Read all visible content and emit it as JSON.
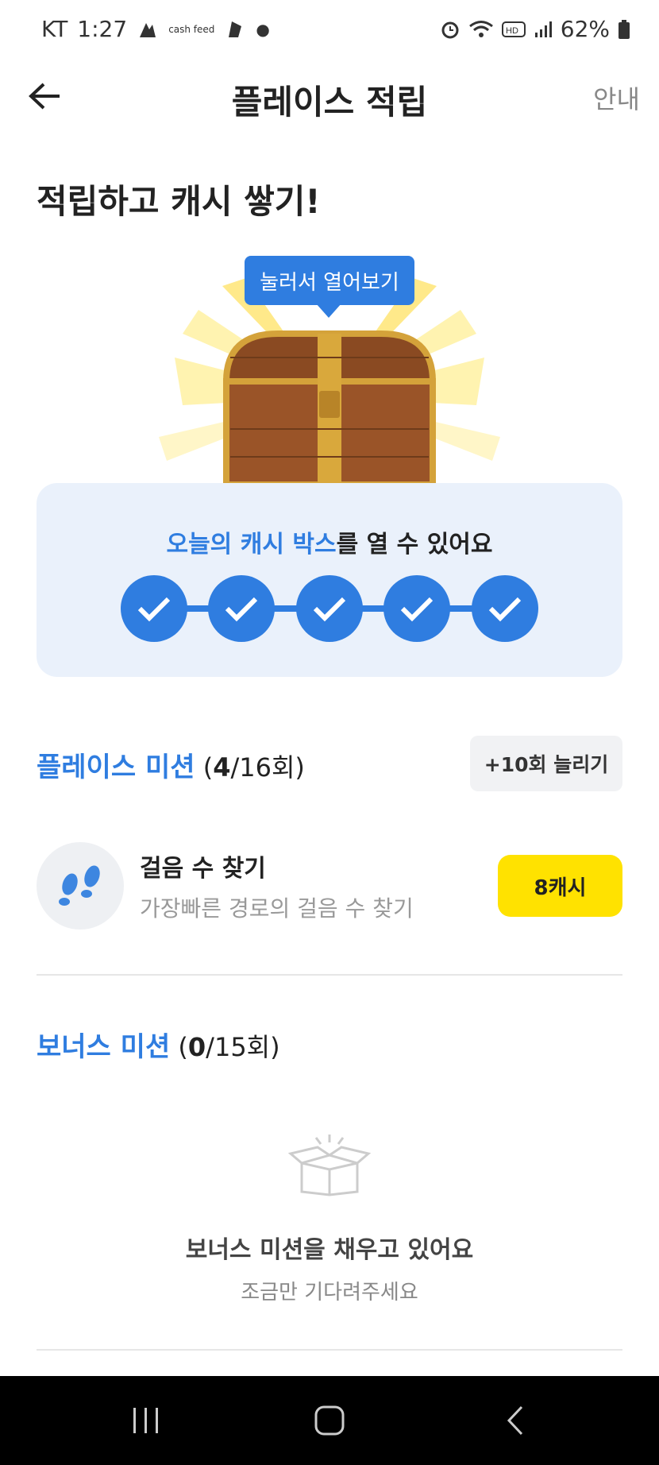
{
  "status_bar": {
    "carrier": "KT",
    "time": "1:27",
    "battery": "62%",
    "app_badge": "cash feed"
  },
  "header": {
    "title": "플레이스 적립",
    "guide": "안내"
  },
  "headline": "적립하고 캐시 쌓기!",
  "chest": {
    "tooltip": "눌러서 열어보기"
  },
  "progress": {
    "text_highlight": "오늘의 캐시 박스",
    "text_rest": "를 열 수 있어요",
    "completed_steps": 5,
    "total_steps": 5
  },
  "place_mission": {
    "title": "플레이스 미션",
    "count_open": " (",
    "count_done": "4",
    "count_rest": "/16회)",
    "extend_label": "+10회 늘리기"
  },
  "mission_item": {
    "icon": "footprints-icon",
    "title": "걸음 수 찾기",
    "desc": "가장빠른 경로의 걸음 수 찾기",
    "reward": "8캐시"
  },
  "bonus_mission": {
    "title": "보너스 미션",
    "count_open": " (",
    "count_done": "0",
    "count_rest": "/15회)",
    "empty_title": "보너스 미션을 채우고 있어요",
    "empty_sub": "조금만 기다려주세요"
  },
  "colors": {
    "accent": "#2f7de0",
    "reward": "#ffe200",
    "card_bg": "#eaf1fb"
  }
}
